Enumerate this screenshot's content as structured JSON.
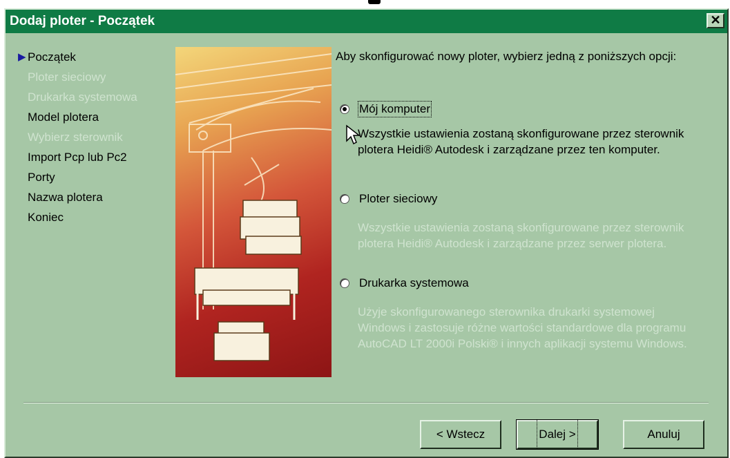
{
  "window": {
    "title": "Dodaj ploter - Początek",
    "close_glyph": "✕"
  },
  "steps": [
    {
      "label": "Początek",
      "state": "active"
    },
    {
      "label": "Ploter sieciowy",
      "state": "disabled"
    },
    {
      "label": "Drukarka systemowa",
      "state": "disabled"
    },
    {
      "label": "Model plotera",
      "state": "enabled"
    },
    {
      "label": "Wybierz sterownik",
      "state": "disabled"
    },
    {
      "label": "Import Pcp lub Pc2",
      "state": "enabled"
    },
    {
      "label": "Porty",
      "state": "enabled"
    },
    {
      "label": "Nazwa plotera",
      "state": "enabled"
    },
    {
      "label": "Koniec",
      "state": "enabled"
    }
  ],
  "main": {
    "intro": "Aby skonfigurować nowy ploter, wybierz jedną z poniższych opcji:",
    "options": [
      {
        "label": "Mój komputer",
        "selected": true,
        "description": "Wszystkie ustawienia zostaną skonfigurowane przez sterownik plotera Heidi® Autodesk i zarządzane przez ten komputer.",
        "enabled": true
      },
      {
        "label": "Ploter sieciowy",
        "selected": false,
        "description": "Wszystkie ustawienia zostaną skonfigurowane przez sterownik plotera Heidi® Autodesk i zarządzane przez serwer plotera.",
        "enabled": false
      },
      {
        "label": "Drukarka systemowa",
        "selected": false,
        "description": "Użyje skonfigurowanego sterownika drukarki systemowej Windows i zastosuje różne wartości standardowe dla programu AutoCAD LT 2000i Polski® i innych aplikacji systemu Windows.",
        "enabled": false
      }
    ]
  },
  "buttons": {
    "back": "< Wstecz",
    "next": "Dalej >",
    "cancel": "Anuluj"
  },
  "colors": {
    "titlebar": "#0f7b45",
    "dialog_bg": "#a6c7a6",
    "disabled_text": "#cfe3cf",
    "step_arrow": "#1a1aa0"
  },
  "icons": {
    "step_marker": "triangle-right-icon",
    "close": "close-icon",
    "cursor": "mouse-pointer-icon"
  }
}
